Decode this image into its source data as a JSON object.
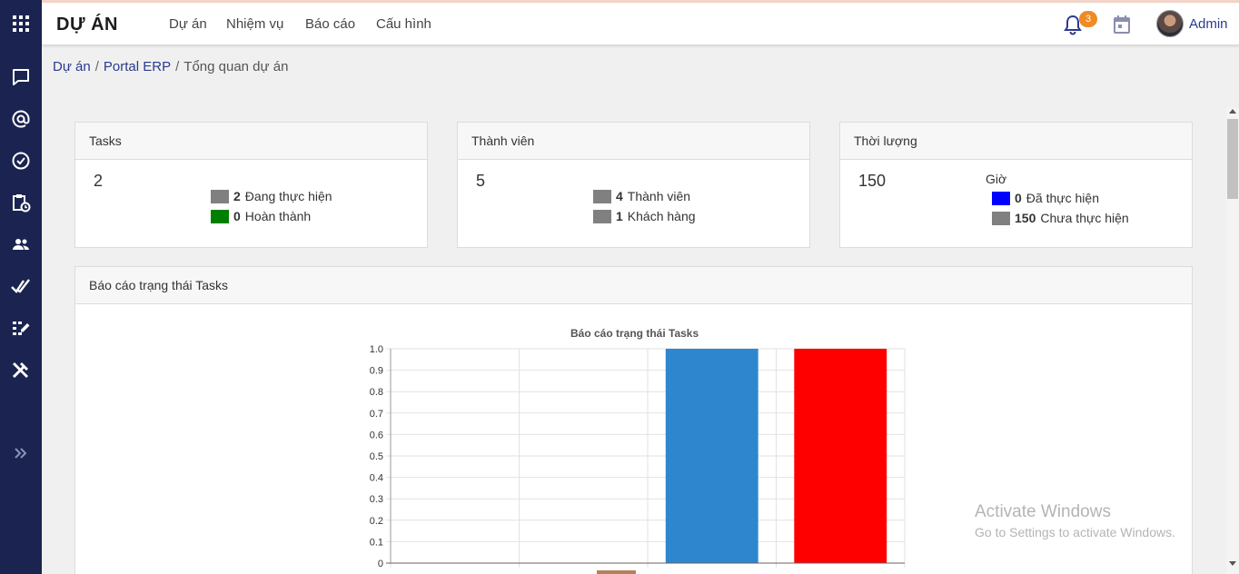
{
  "app": {
    "title": "DỰ ÁN"
  },
  "nav": [
    "Dự án",
    "Nhiệm vụ",
    "Báo cáo",
    "Cấu hình"
  ],
  "notifications": {
    "count": "3"
  },
  "user": {
    "name": "Admin"
  },
  "breadcrumb": {
    "items": [
      "Dự án",
      "Portal ERP"
    ],
    "separator": "/",
    "current": "Tổng quan dự án"
  },
  "sidebar_icons": [
    "apps-grid-icon",
    "chat-icon",
    "at-sign-icon",
    "check-circle-icon",
    "clipboard-clock-icon",
    "people-icon",
    "double-check-icon",
    "grid-edit-icon",
    "tools-icon",
    "expand-chevrons-icon"
  ],
  "cards": {
    "tasks": {
      "title": "Tasks",
      "total": "2",
      "legend": [
        {
          "value": "2",
          "label": "Đang thực hiện",
          "color": "#808080"
        },
        {
          "value": "0",
          "label": "Hoàn thành",
          "color": "#008000"
        }
      ]
    },
    "members": {
      "title": "Thành viên",
      "total": "5",
      "legend": [
        {
          "value": "4",
          "label": "Thành viên",
          "color": "#808080"
        },
        {
          "value": "1",
          "label": "Khách hàng",
          "color": "#808080"
        }
      ]
    },
    "duration": {
      "title": "Thời lượng",
      "total": "150",
      "unit": "Giờ",
      "legend": [
        {
          "value": "0",
          "label": "Đã thực hiện",
          "color": "#0000ff"
        },
        {
          "value": "150",
          "label": "Chưa thực hiện",
          "color": "#808080"
        }
      ]
    }
  },
  "report": {
    "title": "Báo cáo trạng thái Tasks"
  },
  "chart_data": {
    "type": "bar",
    "title": "Báo cáo trạng thái Tasks",
    "ylim": [
      0,
      1.0
    ],
    "yticks": [
      "1.0",
      "0.9",
      "0.8",
      "0.7",
      "0.6",
      "0.5",
      "0.4",
      "0.3",
      "0.2",
      "0.1",
      "0"
    ],
    "values": [
      0,
      0,
      1.0,
      1.0
    ],
    "bar_colors": [
      "#3a87c8",
      "#3a87c8",
      "#2e86cf",
      "#ff0000"
    ],
    "grid": true
  },
  "watermark": {
    "line1": "Activate Windows",
    "line2": "Go to Settings to activate Windows."
  }
}
